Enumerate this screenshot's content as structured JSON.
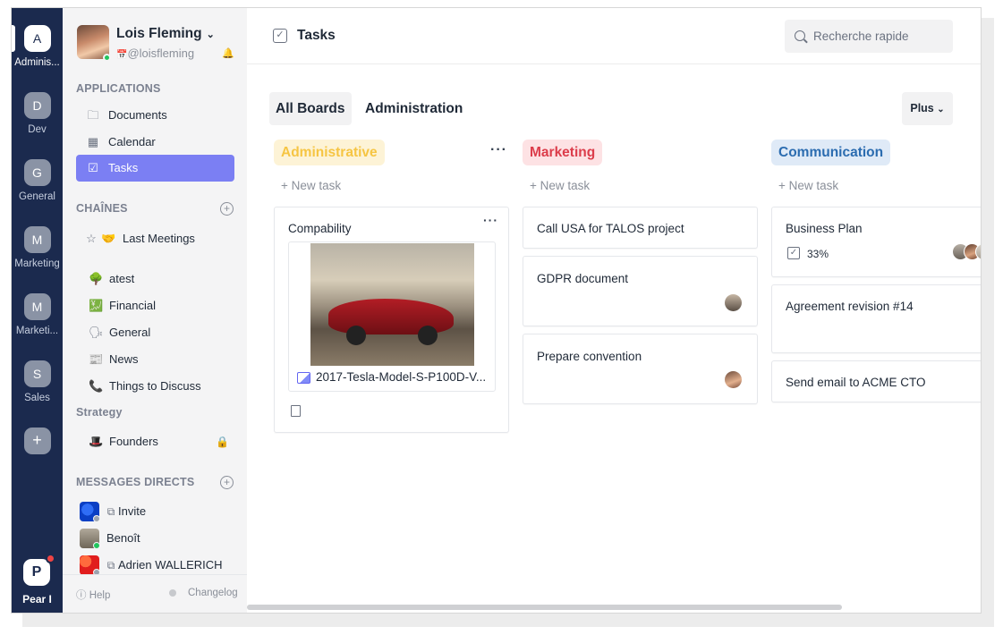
{
  "workspaces": [
    {
      "letter": "A",
      "name": "Adminis...",
      "active": true
    },
    {
      "letter": "D",
      "name": "Dev"
    },
    {
      "letter": "G",
      "name": "General"
    },
    {
      "letter": "M",
      "name": "Marketing"
    },
    {
      "letter": "M",
      "name": "Marketi..."
    },
    {
      "letter": "S",
      "name": "Sales"
    },
    {
      "letter": "+",
      "name": ""
    }
  ],
  "org": {
    "letter": "P",
    "name": "Pear I"
  },
  "user": {
    "name": "Lois Fleming",
    "handle": "@loisfleming",
    "chevron": "⌄"
  },
  "applications": {
    "title": "APPLICATIONS",
    "items": [
      {
        "label": "Documents",
        "icon": "folder-icon"
      },
      {
        "label": "Calendar",
        "icon": "calendar-icon"
      },
      {
        "label": "Tasks",
        "icon": "tasks-icon",
        "selected": true
      }
    ]
  },
  "channels": {
    "title": "CHAÎNES",
    "items": [
      {
        "label": "Last Meetings",
        "emoji": "🤝",
        "starred": true
      },
      {
        "label": "atest",
        "emoji": "🌳"
      },
      {
        "label": "Financial",
        "emoji": "💹"
      },
      {
        "label": "General",
        "emoji": "🗣"
      },
      {
        "label": "News",
        "emoji": "📰"
      },
      {
        "label": "Things to Discuss",
        "emoji": "📞"
      }
    ]
  },
  "strategy": {
    "title": "Strategy",
    "items": [
      {
        "label": "Founders",
        "emoji": "🎩",
        "locked": true
      }
    ]
  },
  "direct": {
    "title": "MESSAGES DIRECTS",
    "items": [
      {
        "label": "Invite",
        "ext": true
      },
      {
        "label": "Benoît"
      },
      {
        "label": "Adrien WALLERICH",
        "ext": true
      }
    ]
  },
  "footer": {
    "help": "Help",
    "changelog": "Changelog"
  },
  "topbar": {
    "title": "Tasks",
    "search_placeholder": "Recherche rapide"
  },
  "tabs": [
    "All Boards",
    "Administration"
  ],
  "more_label": "Plus",
  "new_task_label": "+ New task",
  "columns": [
    {
      "name": "Administrative",
      "color": "#f6c543",
      "bg": "#fdf3d6",
      "cards": [
        {
          "title": "Compability",
          "attachment": "2017-Tesla-Model-S-P100D-V..."
        }
      ]
    },
    {
      "name": "Marketing",
      "color": "#dc3d4b",
      "bg": "#fde2e4",
      "cards": [
        {
          "title": "Call USA for TALOS project"
        },
        {
          "title": "GDPR document"
        },
        {
          "title": "Prepare convention"
        }
      ]
    },
    {
      "name": "Communication",
      "color": "#2b6cb0",
      "bg": "#dfeaf7",
      "cards": [
        {
          "title": "Business Plan",
          "progress": "33%"
        },
        {
          "title": "Agreement revision #14"
        },
        {
          "title": "Send email to ACME CTO"
        }
      ]
    }
  ]
}
